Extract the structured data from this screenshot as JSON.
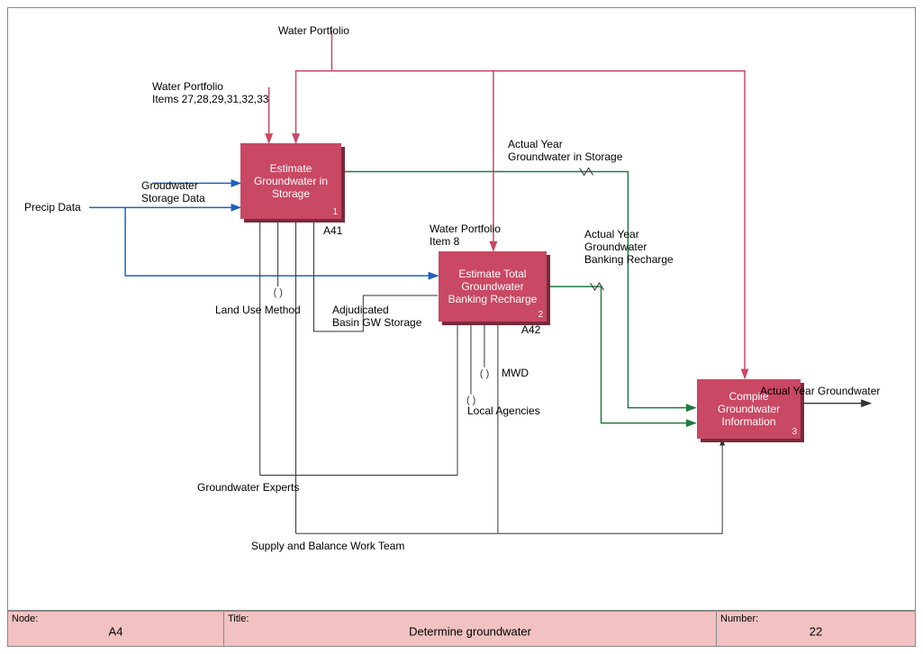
{
  "header_labels": {
    "water_portfolio_top": "Water Portfolio",
    "water_portfolio_items": "Water Portfolio\nItems 27,28,29,31,32,33",
    "precip_data": "Precip Data",
    "groundwater_storage_data": "Groudwater\nStorage Data",
    "actual_year_gw_storage": "Actual Year\nGroundwater in Storage",
    "actual_year_gw_banking": "Actual Year\nGroundwater\nBanking Recharge",
    "water_portfolio_item8": "Water Portfolio\nItem 8",
    "land_use_method": "Land Use Method",
    "adjudicated_basin": "Adjudicated\nBasin GW Storage",
    "mwd": "MWD",
    "local_agencies": "Local Agencies",
    "groundwater_experts": "Groundwater Experts",
    "supply_team": "Supply and Balance Work Team",
    "actual_year_gw": "Actual Year Groundwater"
  },
  "boxes": {
    "b1": {
      "title": "Estimate Groundwater in Storage",
      "num": "1",
      "code": "A41"
    },
    "b2": {
      "title": "Estimate Total Groundwater Banking Recharge",
      "num": "2",
      "code": "A42"
    },
    "b3": {
      "title": "Compile Groundwater Information",
      "num": "3",
      "code": ""
    }
  },
  "footer": {
    "node_label": "Node:",
    "node_value": "A4",
    "title_label": "Title:",
    "title_value": "Determine groundwater",
    "number_label": "Number:",
    "number_value": "22"
  },
  "colors": {
    "box": "#C94863",
    "footer": "#F2C2C2",
    "red_line": "#C94863",
    "blue_line": "#2060C0",
    "green_line": "#1F7A3F",
    "black_line": "#333"
  }
}
